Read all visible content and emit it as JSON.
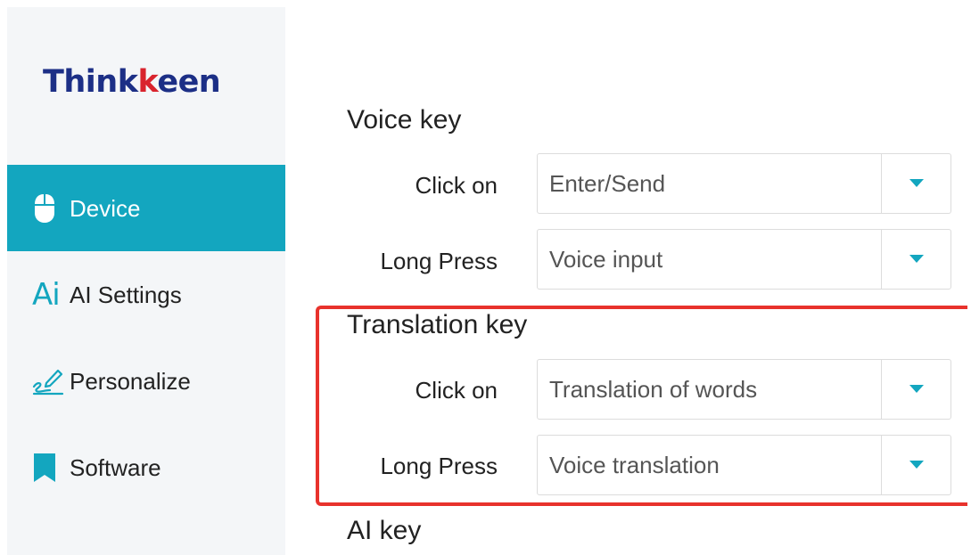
{
  "brand": {
    "logo_prefix": "Think",
    "logo_accent": "k",
    "logo_suffix": "een"
  },
  "sidebar": {
    "items": [
      {
        "label": "Device",
        "icon": "mouse-icon",
        "active": true
      },
      {
        "label": "AI Settings",
        "icon": "ai-icon",
        "icon_text": "Ai",
        "active": false
      },
      {
        "label": "Personalize",
        "icon": "pen-icon",
        "active": false
      },
      {
        "label": "Software",
        "icon": "bookmark-icon",
        "active": false
      }
    ]
  },
  "main": {
    "voice_key": {
      "title": "Voice key",
      "click_label": "Click on",
      "click_value": "Enter/Send",
      "long_label": "Long Press",
      "long_value": "Voice input"
    },
    "translation_key": {
      "title": "Translation key",
      "click_label": "Click on",
      "click_value": "Translation of words",
      "long_label": "Long Press",
      "long_value": "Voice translation"
    },
    "ai_key": {
      "title": "AI key"
    }
  },
  "colors": {
    "accent": "#13a6bf",
    "sidebar_bg": "#f4f6f8",
    "highlight": "#e8322c",
    "logo_blue": "#1c2f86",
    "logo_red": "#d9232d"
  }
}
